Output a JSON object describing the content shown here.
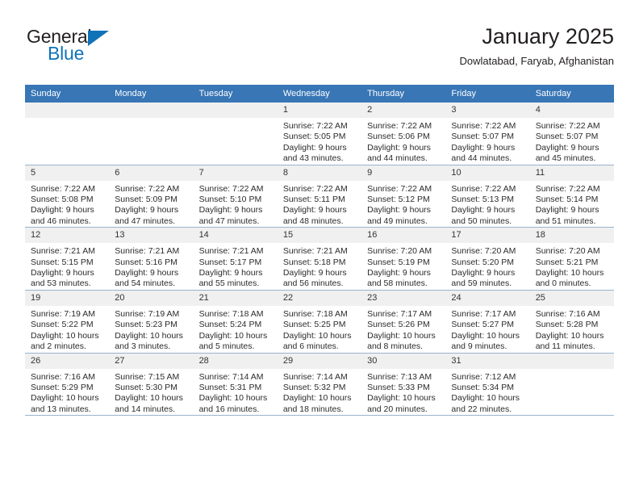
{
  "brand": {
    "name_part1": "General",
    "name_part2": "Blue",
    "triangle_color": "#1073b8",
    "text_color": "#231f20"
  },
  "header": {
    "title": "January 2025",
    "subtitle": "Dowlatabad, Faryab, Afghanistan"
  },
  "theme": {
    "header_bg": "#3876b5",
    "daynum_bg": "#f0f0f0",
    "border": "#9ab3cc"
  },
  "calendar": {
    "weekday_headers": [
      "Sunday",
      "Monday",
      "Tuesday",
      "Wednesday",
      "Thursday",
      "Friday",
      "Saturday"
    ],
    "weeks": [
      [
        {
          "day": "",
          "empty": true
        },
        {
          "day": "",
          "empty": true
        },
        {
          "day": "",
          "empty": true
        },
        {
          "day": "1",
          "sunrise": "Sunrise: 7:22 AM",
          "sunset": "Sunset: 5:05 PM",
          "daylight1": "Daylight: 9 hours",
          "daylight2": "and 43 minutes."
        },
        {
          "day": "2",
          "sunrise": "Sunrise: 7:22 AM",
          "sunset": "Sunset: 5:06 PM",
          "daylight1": "Daylight: 9 hours",
          "daylight2": "and 44 minutes."
        },
        {
          "day": "3",
          "sunrise": "Sunrise: 7:22 AM",
          "sunset": "Sunset: 5:07 PM",
          "daylight1": "Daylight: 9 hours",
          "daylight2": "and 44 minutes."
        },
        {
          "day": "4",
          "sunrise": "Sunrise: 7:22 AM",
          "sunset": "Sunset: 5:07 PM",
          "daylight1": "Daylight: 9 hours",
          "daylight2": "and 45 minutes."
        }
      ],
      [
        {
          "day": "5",
          "sunrise": "Sunrise: 7:22 AM",
          "sunset": "Sunset: 5:08 PM",
          "daylight1": "Daylight: 9 hours",
          "daylight2": "and 46 minutes."
        },
        {
          "day": "6",
          "sunrise": "Sunrise: 7:22 AM",
          "sunset": "Sunset: 5:09 PM",
          "daylight1": "Daylight: 9 hours",
          "daylight2": "and 47 minutes."
        },
        {
          "day": "7",
          "sunrise": "Sunrise: 7:22 AM",
          "sunset": "Sunset: 5:10 PM",
          "daylight1": "Daylight: 9 hours",
          "daylight2": "and 47 minutes."
        },
        {
          "day": "8",
          "sunrise": "Sunrise: 7:22 AM",
          "sunset": "Sunset: 5:11 PM",
          "daylight1": "Daylight: 9 hours",
          "daylight2": "and 48 minutes."
        },
        {
          "day": "9",
          "sunrise": "Sunrise: 7:22 AM",
          "sunset": "Sunset: 5:12 PM",
          "daylight1": "Daylight: 9 hours",
          "daylight2": "and 49 minutes."
        },
        {
          "day": "10",
          "sunrise": "Sunrise: 7:22 AM",
          "sunset": "Sunset: 5:13 PM",
          "daylight1": "Daylight: 9 hours",
          "daylight2": "and 50 minutes."
        },
        {
          "day": "11",
          "sunrise": "Sunrise: 7:22 AM",
          "sunset": "Sunset: 5:14 PM",
          "daylight1": "Daylight: 9 hours",
          "daylight2": "and 51 minutes."
        }
      ],
      [
        {
          "day": "12",
          "sunrise": "Sunrise: 7:21 AM",
          "sunset": "Sunset: 5:15 PM",
          "daylight1": "Daylight: 9 hours",
          "daylight2": "and 53 minutes."
        },
        {
          "day": "13",
          "sunrise": "Sunrise: 7:21 AM",
          "sunset": "Sunset: 5:16 PM",
          "daylight1": "Daylight: 9 hours",
          "daylight2": "and 54 minutes."
        },
        {
          "day": "14",
          "sunrise": "Sunrise: 7:21 AM",
          "sunset": "Sunset: 5:17 PM",
          "daylight1": "Daylight: 9 hours",
          "daylight2": "and 55 minutes."
        },
        {
          "day": "15",
          "sunrise": "Sunrise: 7:21 AM",
          "sunset": "Sunset: 5:18 PM",
          "daylight1": "Daylight: 9 hours",
          "daylight2": "and 56 minutes."
        },
        {
          "day": "16",
          "sunrise": "Sunrise: 7:20 AM",
          "sunset": "Sunset: 5:19 PM",
          "daylight1": "Daylight: 9 hours",
          "daylight2": "and 58 minutes."
        },
        {
          "day": "17",
          "sunrise": "Sunrise: 7:20 AM",
          "sunset": "Sunset: 5:20 PM",
          "daylight1": "Daylight: 9 hours",
          "daylight2": "and 59 minutes."
        },
        {
          "day": "18",
          "sunrise": "Sunrise: 7:20 AM",
          "sunset": "Sunset: 5:21 PM",
          "daylight1": "Daylight: 10 hours",
          "daylight2": "and 0 minutes."
        }
      ],
      [
        {
          "day": "19",
          "sunrise": "Sunrise: 7:19 AM",
          "sunset": "Sunset: 5:22 PM",
          "daylight1": "Daylight: 10 hours",
          "daylight2": "and 2 minutes."
        },
        {
          "day": "20",
          "sunrise": "Sunrise: 7:19 AM",
          "sunset": "Sunset: 5:23 PM",
          "daylight1": "Daylight: 10 hours",
          "daylight2": "and 3 minutes."
        },
        {
          "day": "21",
          "sunrise": "Sunrise: 7:18 AM",
          "sunset": "Sunset: 5:24 PM",
          "daylight1": "Daylight: 10 hours",
          "daylight2": "and 5 minutes."
        },
        {
          "day": "22",
          "sunrise": "Sunrise: 7:18 AM",
          "sunset": "Sunset: 5:25 PM",
          "daylight1": "Daylight: 10 hours",
          "daylight2": "and 6 minutes."
        },
        {
          "day": "23",
          "sunrise": "Sunrise: 7:17 AM",
          "sunset": "Sunset: 5:26 PM",
          "daylight1": "Daylight: 10 hours",
          "daylight2": "and 8 minutes."
        },
        {
          "day": "24",
          "sunrise": "Sunrise: 7:17 AM",
          "sunset": "Sunset: 5:27 PM",
          "daylight1": "Daylight: 10 hours",
          "daylight2": "and 9 minutes."
        },
        {
          "day": "25",
          "sunrise": "Sunrise: 7:16 AM",
          "sunset": "Sunset: 5:28 PM",
          "daylight1": "Daylight: 10 hours",
          "daylight2": "and 11 minutes."
        }
      ],
      [
        {
          "day": "26",
          "sunrise": "Sunrise: 7:16 AM",
          "sunset": "Sunset: 5:29 PM",
          "daylight1": "Daylight: 10 hours",
          "daylight2": "and 13 minutes."
        },
        {
          "day": "27",
          "sunrise": "Sunrise: 7:15 AM",
          "sunset": "Sunset: 5:30 PM",
          "daylight1": "Daylight: 10 hours",
          "daylight2": "and 14 minutes."
        },
        {
          "day": "28",
          "sunrise": "Sunrise: 7:14 AM",
          "sunset": "Sunset: 5:31 PM",
          "daylight1": "Daylight: 10 hours",
          "daylight2": "and 16 minutes."
        },
        {
          "day": "29",
          "sunrise": "Sunrise: 7:14 AM",
          "sunset": "Sunset: 5:32 PM",
          "daylight1": "Daylight: 10 hours",
          "daylight2": "and 18 minutes."
        },
        {
          "day": "30",
          "sunrise": "Sunrise: 7:13 AM",
          "sunset": "Sunset: 5:33 PM",
          "daylight1": "Daylight: 10 hours",
          "daylight2": "and 20 minutes."
        },
        {
          "day": "31",
          "sunrise": "Sunrise: 7:12 AM",
          "sunset": "Sunset: 5:34 PM",
          "daylight1": "Daylight: 10 hours",
          "daylight2": "and 22 minutes."
        },
        {
          "day": "",
          "empty": true
        }
      ]
    ]
  }
}
